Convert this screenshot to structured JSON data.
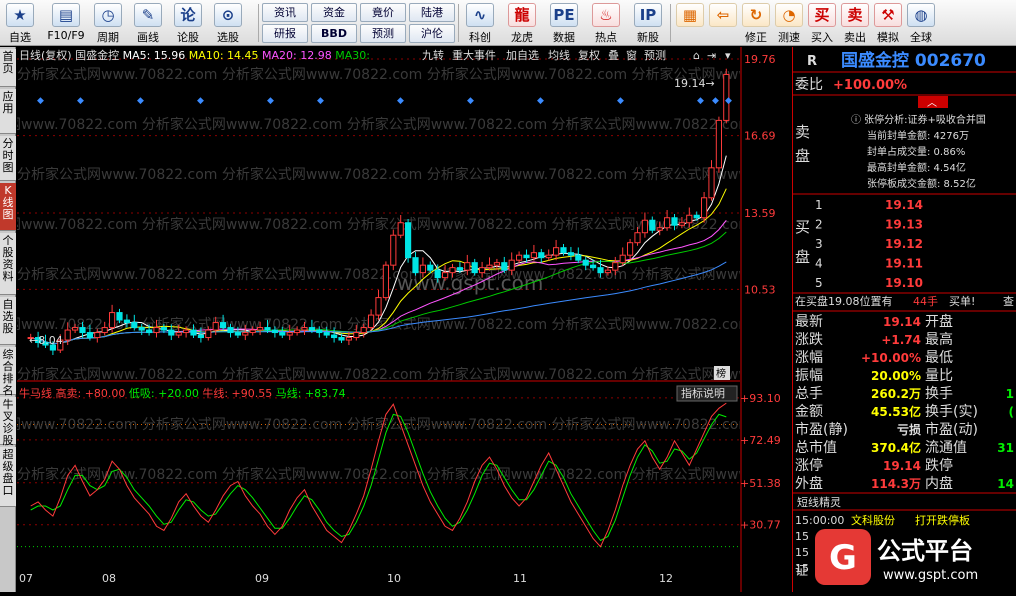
{
  "toolbar": {
    "buttons": [
      {
        "label": "自选",
        "icon": "star-icon"
      },
      {
        "label": "F10/F9",
        "icon": "document-icon"
      },
      {
        "label": "周期",
        "icon": "clock-icon"
      },
      {
        "label": "画线",
        "icon": "pencil-icon"
      },
      {
        "label": "论股",
        "icon": "chat-icon"
      },
      {
        "label": "选股",
        "icon": "filter-icon"
      }
    ],
    "small_buttons": [
      "资讯",
      "资金",
      "竟价",
      "陆港",
      "研报",
      "BBD",
      "预测",
      "沪伦"
    ],
    "buttons2": [
      {
        "label": "科创",
        "icon": "chart-icon"
      },
      {
        "label": "龙虎",
        "icon": "dragon-icon"
      },
      {
        "label": "数据",
        "icon": "pe-icon"
      },
      {
        "label": "热点",
        "icon": "fire-icon"
      },
      {
        "label": "新股",
        "icon": "ipo-icon"
      }
    ],
    "buttons3": [
      {
        "label": "",
        "icon": "grid-icon"
      },
      {
        "label": "",
        "icon": "back-arrow-icon"
      },
      {
        "label": "修正",
        "icon": "refresh-icon"
      },
      {
        "label": "测速",
        "icon": "speedometer-icon"
      },
      {
        "label": "买入",
        "icon": "buy-icon",
        "glyph": "买"
      },
      {
        "label": "卖出",
        "icon": "sell-icon",
        "glyph": "卖"
      },
      {
        "label": "模拟",
        "icon": "hammer-icon"
      },
      {
        "label": "全球",
        "icon": "globe-icon"
      }
    ]
  },
  "left_tabs": [
    "首页",
    "应用",
    "分时图",
    "K线图",
    "个股资料",
    "自选股",
    "综合排名",
    "牛叉诊股",
    "超级盘口"
  ],
  "chart_header": {
    "period": "日线(复权)",
    "name": "国盛金控",
    "ma5": "MA5: 15.96",
    "ma10": "MA10: 14.45",
    "ma20": "MA20: 12.98",
    "ma30": "MA30:",
    "menu": [
      "九转",
      "重大事件",
      "加自选",
      "均线",
      "复权",
      "叠",
      "窗",
      "预测"
    ]
  },
  "indicator_header": {
    "name": "牛马线",
    "high": "高卖: +80.00",
    "low": "低吸: +20.00",
    "bull": "牛线: +90.55",
    "horse": "马线: +83.74",
    "explain": "指标说明"
  },
  "watermark": "分析家公式网www.70822.com",
  "watermark2": "www.gspt.com",
  "chart_labels": {
    "max_price": "19.14",
    "min_price": "8.04",
    "rank_badge": "榜"
  },
  "chart_data": {
    "type": "candlestick",
    "price_axis": [
      "19.76",
      "16.69",
      "13.59",
      "10.53"
    ],
    "price_ylim": [
      7.5,
      19.76
    ],
    "indicator_axis": [
      "+93.10",
      "+72.49",
      "+51.38",
      "+30.77"
    ],
    "indicator_ylim": [
      10,
      96
    ],
    "x_labels": [
      "07",
      "08",
      "09",
      "10",
      "11",
      "12"
    ],
    "high_line": 80,
    "low_line": 20,
    "closes": [
      8.6,
      8.4,
      8.3,
      8.1,
      8.5,
      8.9,
      9.0,
      8.8,
      8.6,
      8.8,
      9.0,
      9.6,
      9.3,
      9.2,
      9.0,
      8.9,
      8.8,
      9.0,
      8.9,
      8.7,
      8.8,
      8.9,
      8.7,
      8.6,
      8.9,
      9.2,
      9.0,
      8.8,
      8.7,
      8.8,
      8.9,
      9.0,
      8.9,
      8.8,
      8.7,
      8.8,
      8.9,
      9.0,
      8.9,
      8.8,
      8.7,
      8.6,
      8.5,
      8.6,
      8.8,
      9.0,
      9.5,
      10.2,
      11.5,
      12.7,
      13.2,
      11.8,
      11.2,
      11.5,
      11.3,
      11.0,
      11.2,
      11.4,
      11.3,
      11.6,
      11.2,
      11.4,
      11.5,
      11.6,
      11.3,
      11.7,
      11.9,
      11.8,
      12.0,
      11.8,
      11.9,
      12.2,
      12.0,
      11.9,
      11.7,
      11.5,
      11.4,
      11.2,
      11.3,
      11.6,
      11.9,
      12.4,
      12.8,
      13.3,
      12.9,
      13.0,
      13.4,
      13.1,
      13.2,
      13.5,
      13.4,
      14.2,
      15.4,
      17.3,
      19.14
    ],
    "bull_line": [
      40,
      42,
      38,
      35,
      44,
      55,
      60,
      52,
      45,
      48,
      53,
      62,
      58,
      50,
      44,
      40,
      36,
      30,
      28,
      34,
      42,
      46,
      40,
      35,
      32,
      38,
      45,
      50,
      52,
      45,
      40,
      36,
      30,
      26,
      30,
      38,
      44,
      48,
      40,
      34,
      28,
      25,
      22,
      28,
      36,
      45,
      58,
      72,
      85,
      90,
      80,
      70,
      60,
      50,
      42,
      36,
      30,
      28,
      34,
      42,
      52,
      60,
      64,
      58,
      50,
      44,
      40,
      44,
      52,
      60,
      66,
      58,
      50,
      42,
      36,
      30,
      24,
      20,
      28,
      38,
      50,
      60,
      68,
      72,
      64,
      58,
      64,
      72,
      66,
      60,
      68,
      76,
      84,
      88,
      90.55
    ],
    "horse_line": [
      38,
      40,
      40,
      38,
      40,
      48,
      55,
      55,
      50,
      48,
      50,
      57,
      58,
      54,
      48,
      44,
      40,
      35,
      31,
      32,
      38,
      43,
      42,
      38,
      35,
      36,
      41,
      46,
      50,
      48,
      44,
      39,
      34,
      29,
      29,
      34,
      40,
      45,
      43,
      38,
      32,
      28,
      25,
      26,
      32,
      40,
      50,
      63,
      76,
      85,
      84,
      76,
      66,
      56,
      47,
      40,
      34,
      30,
      32,
      38,
      46,
      55,
      61,
      60,
      54,
      48,
      43,
      43,
      48,
      55,
      62,
      60,
      54,
      46,
      40,
      34,
      28,
      23,
      25,
      33,
      44,
      55,
      64,
      70,
      67,
      61,
      62,
      68,
      67,
      63,
      66,
      73,
      80,
      85,
      83.74
    ]
  },
  "right_panel": {
    "code_title": "国盛金控 002670",
    "r_mark": "R",
    "weibi_label": "委比",
    "weibi_value": "+100.00%",
    "sell_label": [
      "卖",
      "盘"
    ],
    "buy_label": [
      "买",
      "盘"
    ],
    "limit_analysis": [
      "张停分析:证券+吸收合并国",
      "当前封单金额: 4276万",
      "封单占成交量: 0.86%",
      "最高封单金额: 4.54亿",
      "张停板成交金额: 8.52亿"
    ],
    "buy_levels": [
      {
        "n": "1",
        "price": "19.14"
      },
      {
        "n": "2",
        "price": "19.13"
      },
      {
        "n": "3",
        "price": "19.12"
      },
      {
        "n": "4",
        "price": "19.11"
      },
      {
        "n": "5",
        "price": "19.10"
      }
    ],
    "queue_text": "在买盘19.08位置有",
    "queue_qty": "44手",
    "queue_buy": "买单!",
    "queue_check": "查",
    "stats": [
      {
        "l": "最新",
        "v": "19.14",
        "c": "#ff3b3b",
        "l2": "开盘",
        "v2": ""
      },
      {
        "l": "涨跌",
        "v": "+1.74",
        "c": "#ff3b3b",
        "l2": "最高",
        "v2": ""
      },
      {
        "l": "涨幅",
        "v": "+10.00%",
        "c": "#ff3b3b",
        "l2": "最低",
        "v2": ""
      },
      {
        "l": "振幅",
        "v": "20.00%",
        "c": "#ffff00",
        "l2": "量比",
        "v2": ""
      },
      {
        "l": "总手",
        "v": "260.2万",
        "c": "#ffff00",
        "l2": "换手",
        "v2": "1"
      },
      {
        "l": "金额",
        "v": "45.53亿",
        "c": "#ffff00",
        "l2": "换手(实)",
        "v2": "(",
        "l2c": "#ddd"
      },
      {
        "l": "市盈(静)",
        "v": "亏损",
        "c": "#ddd",
        "l2": "市盈(动)",
        "v2": ""
      },
      {
        "l": "总市值",
        "v": "370.4亿",
        "c": "#ffff00",
        "l2": "流通值",
        "v2": "31"
      },
      {
        "l": "涨停",
        "v": "19.14",
        "c": "#ff3b3b",
        "l2": "跌停",
        "v2": ""
      },
      {
        "l": "外盘",
        "v": "114.3万",
        "c": "#ff3b3b",
        "l2": "内盘",
        "v2": "14"
      }
    ],
    "spirit_title": "短线精灵",
    "spirit_rows": [
      {
        "time": "15:00:00",
        "name": "文科股份",
        "event": "打开跌停板"
      },
      {
        "time": "15",
        "name": "",
        "event": ""
      },
      {
        "time": "15",
        "name": "",
        "event": ""
      },
      {
        "time": "15",
        "name": "",
        "event": ""
      }
    ],
    "bottom_tab": "证",
    "logo_text": "公式平台",
    "logo_url": "www.gspt.com"
  }
}
